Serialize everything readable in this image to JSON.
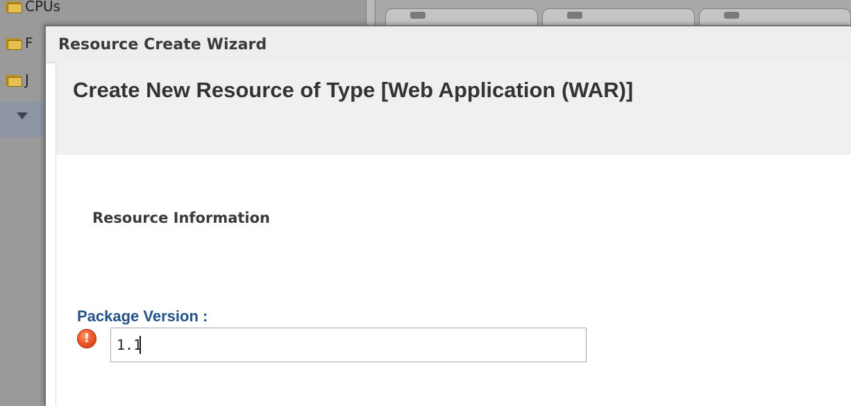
{
  "background": {
    "tree_items": [
      {
        "label": "CPUs"
      },
      {
        "label": "F"
      },
      {
        "label": "J"
      }
    ]
  },
  "dialog": {
    "title": "Resource Create Wizard",
    "header": "Create New Resource of Type [Web Application (WAR)]",
    "section_title": "Resource Information",
    "fields": {
      "package_version": {
        "label": "Package Version :",
        "value": "1.1",
        "status_icon": "error-icon"
      }
    }
  },
  "colors": {
    "label_blue": "#24528a",
    "error_orange": "#f0592b"
  }
}
